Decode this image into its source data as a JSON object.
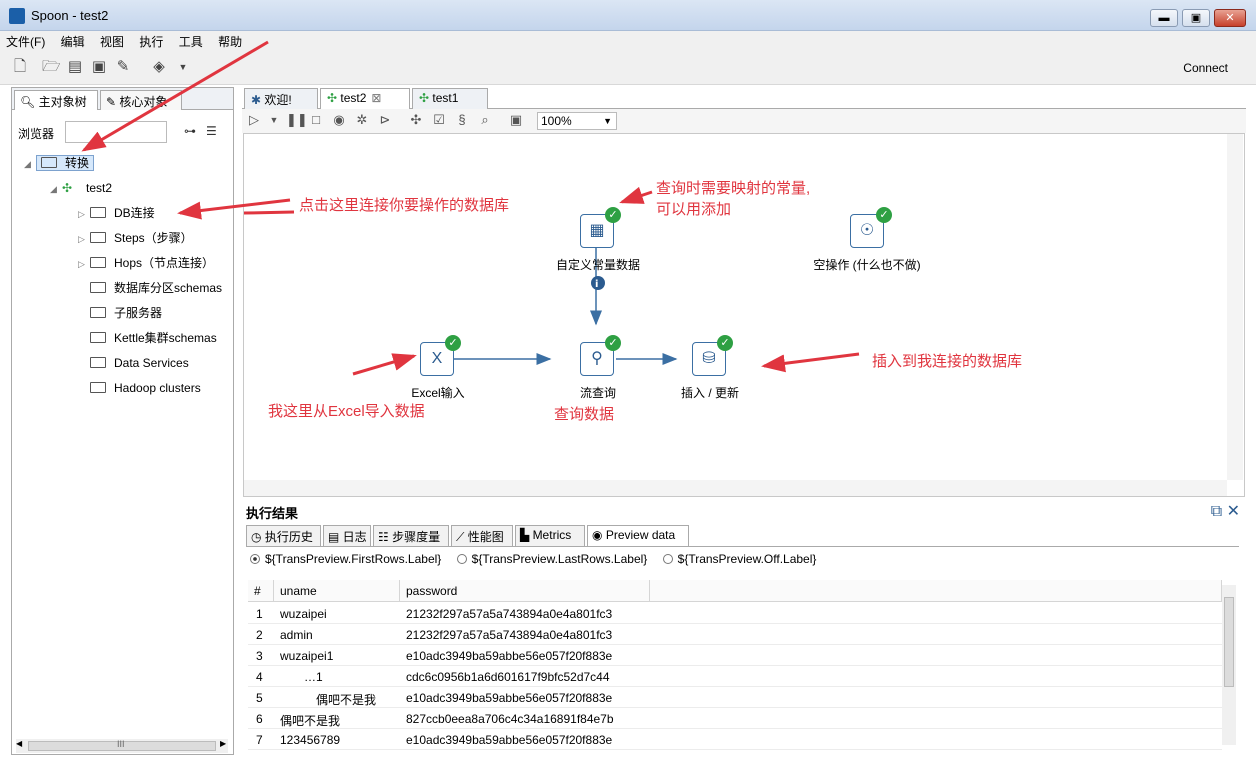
{
  "window": {
    "title": "Spoon - test2",
    "min": "▬",
    "max": "▣",
    "close": "✕"
  },
  "menu": [
    "文件(F)",
    "编辑",
    "视图",
    "执行",
    "工具",
    "帮助"
  ],
  "toolbar": {
    "connect_label": "Connect"
  },
  "left": {
    "tabs": [
      "主对象树",
      "核心对象"
    ],
    "browser_label": "浏览器",
    "root": "转换",
    "transform": "test2",
    "items": [
      "DB连接",
      "Steps（步骤）",
      "Hops（节点连接）",
      "数据库分区schemas",
      "子服务器",
      "Kettle集群schemas",
      "Data Services",
      "Hadoop clusters"
    ],
    "hscroll_mark": "III"
  },
  "tabs": [
    "欢迎!",
    "test2",
    "test1"
  ],
  "zoom": "100%",
  "canvas": {
    "steps": {
      "const": "自定义常量数据",
      "dummy": "空操作 (什么也不做)",
      "excel": "Excel输入",
      "lookup": "流查询",
      "insert": "插入 / 更新"
    },
    "annotations": {
      "db": "点击这里连接你要操作的数据库",
      "const_1": "查询时需要映射的常量,",
      "const_2": "可以用添加",
      "insert": "插入到我连接的数据库",
      "excel": "我这里从Excel导入数据",
      "lookup": "查询数据"
    }
  },
  "results": {
    "title": "执行结果",
    "tabs": [
      "执行历史",
      "日志",
      "步骤度量",
      "性能图",
      "Metrics",
      "Preview data"
    ],
    "radios": [
      "${TransPreview.FirstRows.Label}",
      "${TransPreview.LastRows.Label}",
      "${TransPreview.Off.Label}"
    ],
    "columns": [
      "#",
      "uname",
      "password"
    ],
    "rows": [
      {
        "n": "1",
        "uname": "wuzaipei",
        "password": "21232f297a57a5a743894a0e4a801fc3"
      },
      {
        "n": "2",
        "uname": "admin",
        "password": "21232f297a57a5a743894a0e4a801fc3"
      },
      {
        "n": "3",
        "uname": "wuzaipei1",
        "password": "e10adc3949ba59abbe56e057f20f883e"
      },
      {
        "n": "4",
        "uname": "…1",
        "password": "cdc6c0956b1a6d601617f9bfc52d7c44"
      },
      {
        "n": "5",
        "uname": "偶吧不是我",
        "password": "e10adc3949ba59abbe56e057f20f883e"
      },
      {
        "n": "6",
        "uname": "偶吧不是我",
        "password": "827ccb0eea8a706c4c34a16891f84e7b"
      },
      {
        "n": "7",
        "uname": "123456789",
        "password": "e10adc3949ba59abbe56e057f20f883e"
      }
    ]
  },
  "colors": {
    "accent": "#2b5b8f",
    "ok": "#2ea043",
    "annotation": "#e0353f"
  }
}
